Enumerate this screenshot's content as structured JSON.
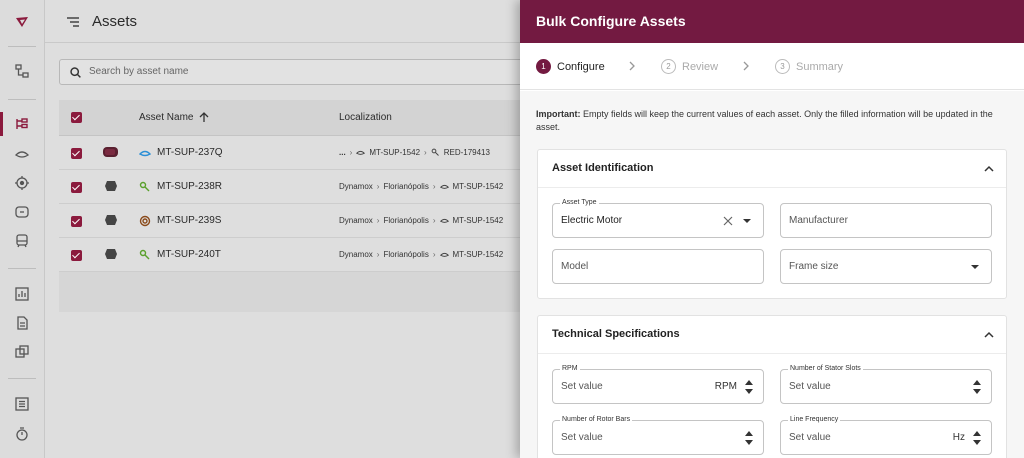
{
  "app": {
    "page_title": "Assets"
  },
  "search": {
    "placeholder": "Search by asset name"
  },
  "table": {
    "headers": {
      "asset_name": "Asset Name",
      "localization": "Localization"
    },
    "rows": [
      {
        "name": "MT-SUP-237Q",
        "loc": [
          "...",
          "MT-SUP-1542",
          "RED-179413"
        ]
      },
      {
        "name": "MT-SUP-238R",
        "loc": [
          "Dynamox",
          "Florianópolis",
          "MT-SUP-1542"
        ]
      },
      {
        "name": "MT-SUP-239S",
        "loc": [
          "Dynamox",
          "Florianópolis",
          "MT-SUP-1542"
        ]
      },
      {
        "name": "MT-SUP-240T",
        "loc": [
          "Dynamox",
          "Florianópolis",
          "MT-SUP-1542"
        ]
      }
    ]
  },
  "drawer": {
    "title": "Bulk Configure Assets",
    "steps": [
      {
        "num": "1",
        "label": "Configure"
      },
      {
        "num": "2",
        "label": "Review"
      },
      {
        "num": "3",
        "label": "Summary"
      }
    ],
    "notice_strong": "Important:",
    "notice_text": " Empty fields will keep the current values of each asset. Only the filled information will be updated in the asset.",
    "identification": {
      "title": "Asset Identification",
      "asset_type_label": "Asset Type",
      "asset_type_value": "Electric Motor",
      "manufacturer": "Manufacturer",
      "model": "Model",
      "frame_size": "Frame size"
    },
    "technical": {
      "title": "Technical Specifications",
      "rpm_label": "RPM",
      "rpm_unit": "RPM",
      "stator_label": "Number of Stator Slots",
      "rotor_label": "Number of Rotor Bars",
      "freq_label": "Line Frequency",
      "freq_unit": "Hz",
      "set_value": "Set value"
    }
  },
  "colors": {
    "brand": "#731a41",
    "check": "#8b1a3d"
  }
}
